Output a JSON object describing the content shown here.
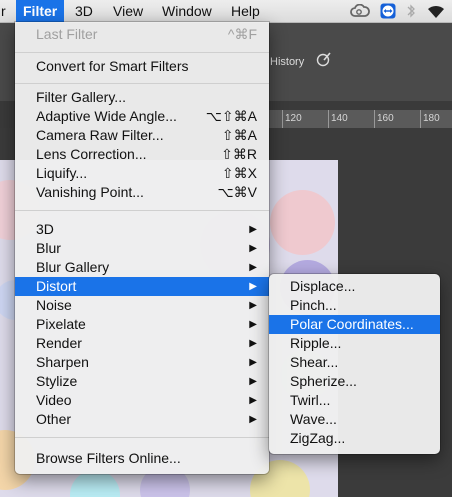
{
  "menubar": {
    "items": [
      "r",
      "Filter",
      "3D",
      "View",
      "Window",
      "Help"
    ],
    "active_index": 1
  },
  "optionsbar": {
    "history_label": "History"
  },
  "ruler": {
    "ticks": [
      "120",
      "140",
      "160",
      "180"
    ]
  },
  "filter_menu": {
    "items": [
      {
        "label": "Last Filter",
        "shortcut": "^⌘F",
        "disabled": true
      },
      {
        "label": "Convert for Smart Filters"
      },
      {
        "label": "Filter Gallery..."
      },
      {
        "label": "Adaptive Wide Angle...",
        "shortcut": "⌥⇧⌘A"
      },
      {
        "label": "Camera Raw Filter...",
        "shortcut": "⇧⌘A"
      },
      {
        "label": "Lens Correction...",
        "shortcut": "⇧⌘R"
      },
      {
        "label": "Liquify...",
        "shortcut": "⇧⌘X"
      },
      {
        "label": "Vanishing Point...",
        "shortcut": "⌥⌘V"
      },
      {
        "label": "3D",
        "submenu": true
      },
      {
        "label": "Blur",
        "submenu": true
      },
      {
        "label": "Blur Gallery",
        "submenu": true
      },
      {
        "label": "Distort",
        "submenu": true,
        "highlighted": true
      },
      {
        "label": "Noise",
        "submenu": true
      },
      {
        "label": "Pixelate",
        "submenu": true
      },
      {
        "label": "Render",
        "submenu": true
      },
      {
        "label": "Sharpen",
        "submenu": true
      },
      {
        "label": "Stylize",
        "submenu": true
      },
      {
        "label": "Video",
        "submenu": true
      },
      {
        "label": "Other",
        "submenu": true
      },
      {
        "label": "Browse Filters Online..."
      }
    ],
    "arrow_glyph": "▶"
  },
  "distort_submenu": {
    "items": [
      {
        "label": "Displace..."
      },
      {
        "label": "Pinch..."
      },
      {
        "label": "Polar Coordinates...",
        "highlighted": true
      },
      {
        "label": "Ripple..."
      },
      {
        "label": "Shear..."
      },
      {
        "label": "Spherize..."
      },
      {
        "label": "Twirl..."
      },
      {
        "label": "Wave..."
      },
      {
        "label": "ZigZag..."
      }
    ]
  },
  "colors": {
    "highlight": "#1a73e8",
    "menu_bg": "#eeeeee"
  },
  "icons": [
    "creative-cloud-icon",
    "teamviewer-icon",
    "bluetooth-icon",
    "wifi-icon",
    "history-brush-icon"
  ]
}
